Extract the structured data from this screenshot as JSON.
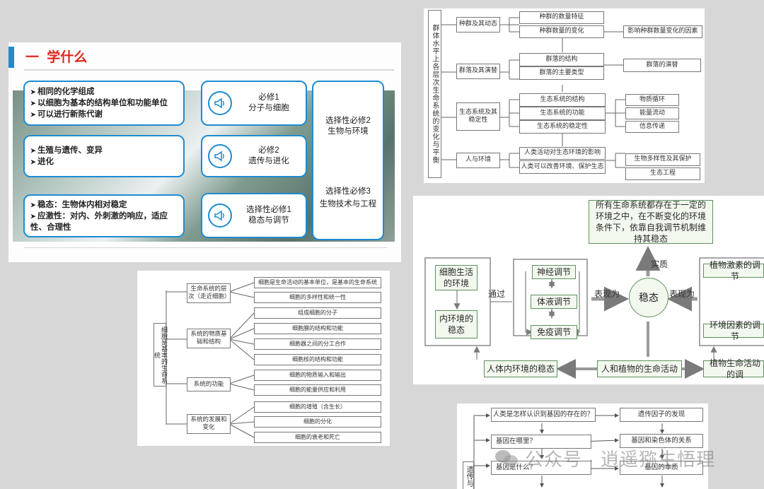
{
  "slide": {
    "title_dash": "一",
    "title": "学什么",
    "left_groups": [
      [
        "相同的化学组成",
        "以细胞为基本的结构单位和功能单位",
        "可以进行新陈代谢"
      ],
      [
        "生殖与遗传、变异",
        "进化"
      ],
      [
        "稳态：生物体内相对稳定",
        "应激性：对内、外刺激的响应，适应性、合理性"
      ]
    ],
    "courses": [
      {
        "line1": "必修1",
        "line2": "分子与细胞"
      },
      {
        "line1": "必修2",
        "line2": "遗传与进化"
      },
      {
        "line1": "选择性必修1",
        "line2": "稳态与调节"
      }
    ],
    "right": {
      "c2_line1": "选择性必修2",
      "c2_line2": "生物与环境",
      "c3_line1": "选择性必修3",
      "c3_line2": "生物技术与工程"
    },
    "colors": {
      "accent": "#1e8bd1",
      "title_red": "#e0261b"
    }
  },
  "ecology_map": {
    "root": "群体水平上各层次生命系统的变化与平衡",
    "groups": [
      {
        "label": "种群及其动态",
        "items": [
          "种群的数量特征",
          "种群数量的变化"
        ],
        "extra": [
          "影响种群数量变化的因素"
        ]
      },
      {
        "label": "群落及其演替",
        "items": [
          "群落的结构",
          "群落的主要类型"
        ],
        "extra": [
          "群落的演替"
        ]
      },
      {
        "label": "生态系统及其稳定性",
        "items": [
          "生态系统的结构",
          "生态系统的功能",
          "生态系统的稳定性"
        ],
        "extra": [
          "物质循环",
          "能量流动",
          "信息传递"
        ]
      },
      {
        "label": "人与环境",
        "items": [
          "人类活动对生态环境的影响",
          "人类可以改善环境、保护生态"
        ],
        "extra": [
          "生物多样性及其保护",
          "生态工程"
        ]
      }
    ]
  },
  "cell_map": {
    "root": "细胞是基本的生命系统",
    "groups": [
      {
        "label": "生命系统的层次（走近细胞）",
        "items": [
          "细胞是生命活动的基本单位，是基本的生命系统",
          "细胞的多样性和统一性"
        ]
      },
      {
        "label": "系统的物质基础和结构",
        "items": [
          "组成细胞的分子",
          "细胞膜的结构和功能",
          "细胞器之间的分工合作",
          "细胞核的结构和功能"
        ]
      },
      {
        "label": "系统的功能",
        "items": [
          "细胞的物质输入和输出",
          "细胞的能量供应和利用"
        ]
      },
      {
        "label": "系统的发展和变化",
        "items": [
          "细胞的增殖（含生长）",
          "细胞的分化",
          "细胞的衰老和死亡"
        ]
      }
    ]
  },
  "homeostasis_map": {
    "top": "所有生命系统都存在于一定的环境之中，在不断变化的环境条件下，依靠自我调节机制维持其稳态",
    "shizhi": "实质",
    "left1": "细胞生活的环境",
    "left2": "内环境的稳态",
    "tongguo": "通过",
    "reg": [
      "神经调节",
      "体液调节",
      "免疫调节"
    ],
    "biaoxian1": "表现为",
    "center": "稳态",
    "biaoxian2": "表现为",
    "right1": "植物激素的调节",
    "right2": "环境因素的调节",
    "bottom_left": "人体内环境的稳态",
    "bottom_mid": "人和植物的生命活动",
    "bottom_right": "植物生命活动的调"
  },
  "gene_map": {
    "side": "遗传与",
    "rows": [
      {
        "q": "人类是怎样认识到基因的存在的？",
        "a": "遗传因子的发现"
      },
      {
        "q": "基因在哪里？",
        "a": "基因和染色体的关系"
      },
      {
        "q": "基因是什么？",
        "a": "基因的本质"
      }
    ]
  },
  "watermark": "公众号 · 逍遥猕生悟理"
}
